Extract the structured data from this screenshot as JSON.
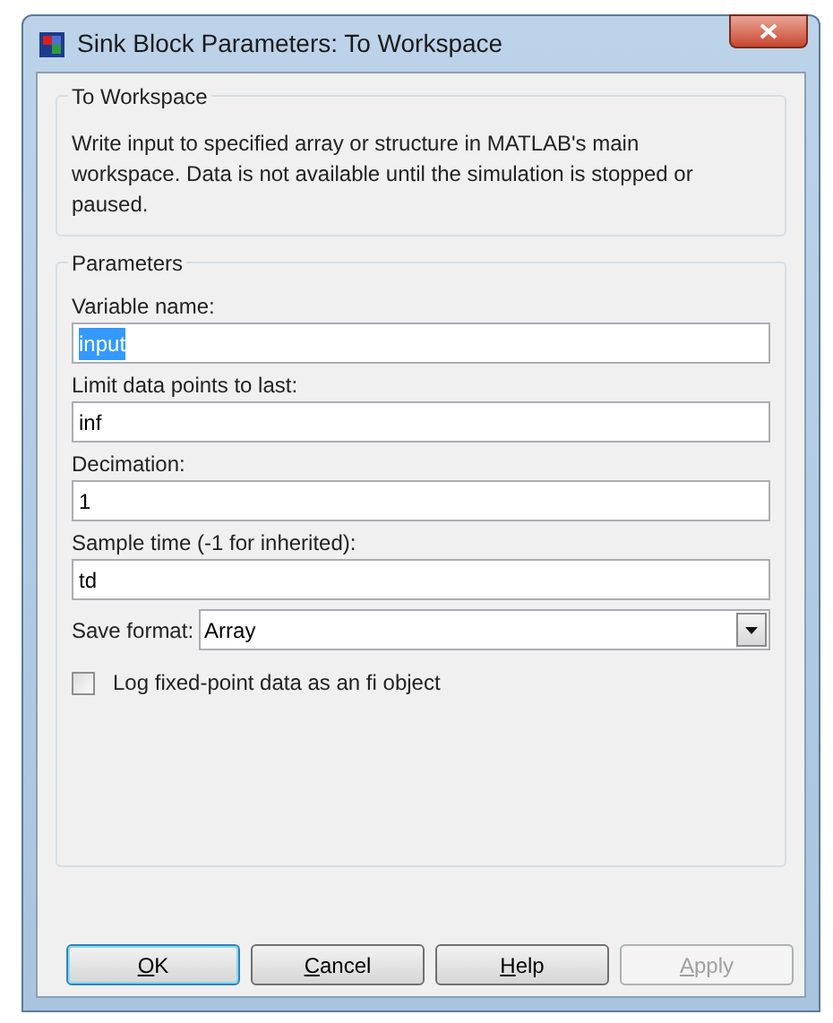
{
  "window": {
    "title": "Sink Block Parameters: To Workspace"
  },
  "description_group": {
    "title": "To Workspace",
    "text": "Write input to specified array or structure in MATLAB's main workspace. Data is not available until the simulation is stopped or paused."
  },
  "parameters": {
    "title": "Parameters",
    "fields": [
      {
        "label": "Variable name:",
        "value": "input",
        "selected": true
      },
      {
        "label": "Limit data points to last:",
        "value": "inf",
        "selected": false
      },
      {
        "label": "Decimation:",
        "value": "1",
        "selected": false
      },
      {
        "label": "Sample time (-1 for inherited):",
        "value": "td",
        "selected": false
      }
    ],
    "save_format": {
      "label": "Save format:",
      "value": "Array"
    },
    "checkbox": {
      "label": "Log fixed-point data as an fi object",
      "checked": false
    }
  },
  "buttons": [
    {
      "label": "OK",
      "default": true,
      "disabled": false,
      "mnemonic_first": true
    },
    {
      "label": "Cancel",
      "default": false,
      "disabled": false,
      "mnemonic_first": true
    },
    {
      "label": "Help",
      "default": false,
      "disabled": false,
      "mnemonic_first": true
    },
    {
      "label": "Apply",
      "default": false,
      "disabled": true,
      "mnemonic_first": true
    }
  ]
}
